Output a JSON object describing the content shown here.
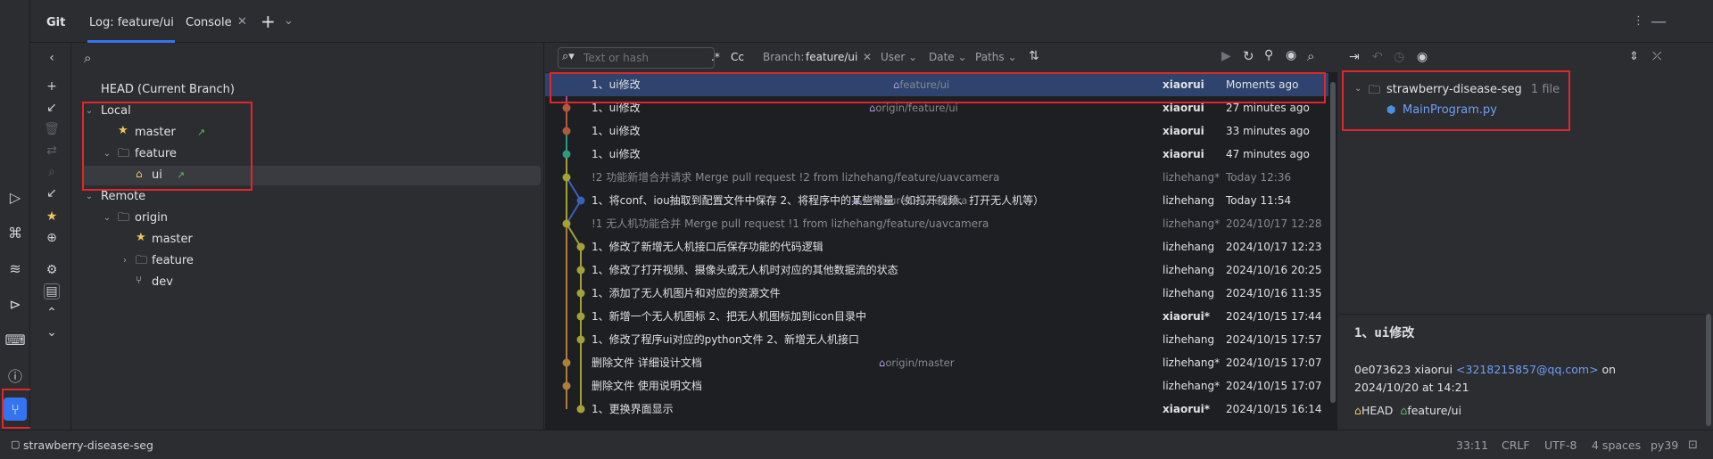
{
  "tool_window": {
    "title": "Git",
    "tabs": [
      {
        "label": "Log: feature/ui"
      },
      {
        "label": "Console"
      }
    ]
  },
  "branches": {
    "head": "HEAD (Current Branch)",
    "local_label": "Local",
    "local_master": "master",
    "local_feature": "feature",
    "local_ui": "ui",
    "remote_label": "Remote",
    "origin": "origin",
    "origin_master": "master",
    "origin_feature": "feature",
    "origin_dev": "dev"
  },
  "log_toolbar": {
    "search_placeholder": "Text or hash",
    "regex": ".*",
    "case": "Cc",
    "branch_label": "Branch:",
    "branch_value": "feature/ui",
    "filters": [
      "User",
      "Date",
      "Paths"
    ]
  },
  "commits": [
    {
      "message": "1、ui修改",
      "ref": "feature/ui",
      "author": "xiaorui",
      "date": "Moments ago"
    },
    {
      "message": "1、ui修改",
      "ref": "origin/feature/ui",
      "author": "xiaorui",
      "date": "27 minutes ago"
    },
    {
      "message": "1、ui修改",
      "ref": "",
      "author": "xiaorui",
      "date": "33 minutes ago"
    },
    {
      "message": "1、ui修改",
      "ref": "",
      "author": "xiaorui",
      "date": "47 minutes ago"
    },
    {
      "message": "!2 功能新增合并请求 Merge pull request !2 from lizhehang/feature/uavcamera",
      "ref": "",
      "author": "lizhehang*",
      "date": "Today 12:36"
    },
    {
      "message": "1、将conf、iou抽取到配置文件中保存 2、将程序中的某些常量（如打开视频、打开无人机等）",
      "ref": "../feature/uavcamera",
      "author": "lizhehang",
      "date": "Today 11:54"
    },
    {
      "message": "!1 无人机功能合并 Merge pull request !1 from lizhehang/feature/uavcamera",
      "ref": "",
      "author": "lizhehang*",
      "date": "2024/10/17 12:28"
    },
    {
      "message": "1、修改了新增无人机接口后保存功能的代码逻辑",
      "ref": "",
      "author": "lizhehang",
      "date": "2024/10/17 12:23"
    },
    {
      "message": "1、修改了打开视频、摄像头或无人机时对应的其他数据流的状态",
      "ref": "",
      "author": "lizhehang",
      "date": "2024/10/16 20:25"
    },
    {
      "message": "1、添加了无人机图片和对应的资源文件",
      "ref": "",
      "author": "lizhehang",
      "date": "2024/10/16 11:35"
    },
    {
      "message": "1、新增一个无人机图标 2、把无人机图标加到icon目录中",
      "ref": "",
      "author": "xiaorui*",
      "date": "2024/10/15 17:44"
    },
    {
      "message": "1、修改了程序ui对应的python文件 2、新增无人机接口",
      "ref": "",
      "author": "lizhehang",
      "date": "2024/10/15 17:57"
    },
    {
      "message": "删除文件 详细设计文档",
      "ref": "origin/master",
      "author": "lizhehang*",
      "date": "2024/10/15 17:07"
    },
    {
      "message": "删除文件 使用说明文档",
      "ref": "",
      "author": "lizhehang*",
      "date": "2024/10/15 17:07"
    },
    {
      "message": "1、更换界面显示",
      "ref": "",
      "author": "xiaorui*",
      "date": "2024/10/15 16:14"
    }
  ],
  "changes": {
    "root": "strawberry-disease-seg",
    "count": "1 file",
    "file": "MainProgram.py"
  },
  "details": {
    "title": "1、ui修改",
    "hash_author": "0e073623 xiaorui",
    "email": "<3218215857@qq.com>",
    "on": "on",
    "date": "2024/10/20 at 14:21",
    "ref_head": "HEAD",
    "ref_branch": "feature/ui"
  },
  "status": {
    "project": "strawberry-disease-seg",
    "position": "33:11",
    "line_sep": "CRLF",
    "encoding": "UTF-8",
    "indent": "4 spaces",
    "interpreter": "py39"
  },
  "colors": {
    "accent": "#3574f0",
    "selection": "#2e436e",
    "highlight_box": "#e0272b"
  }
}
